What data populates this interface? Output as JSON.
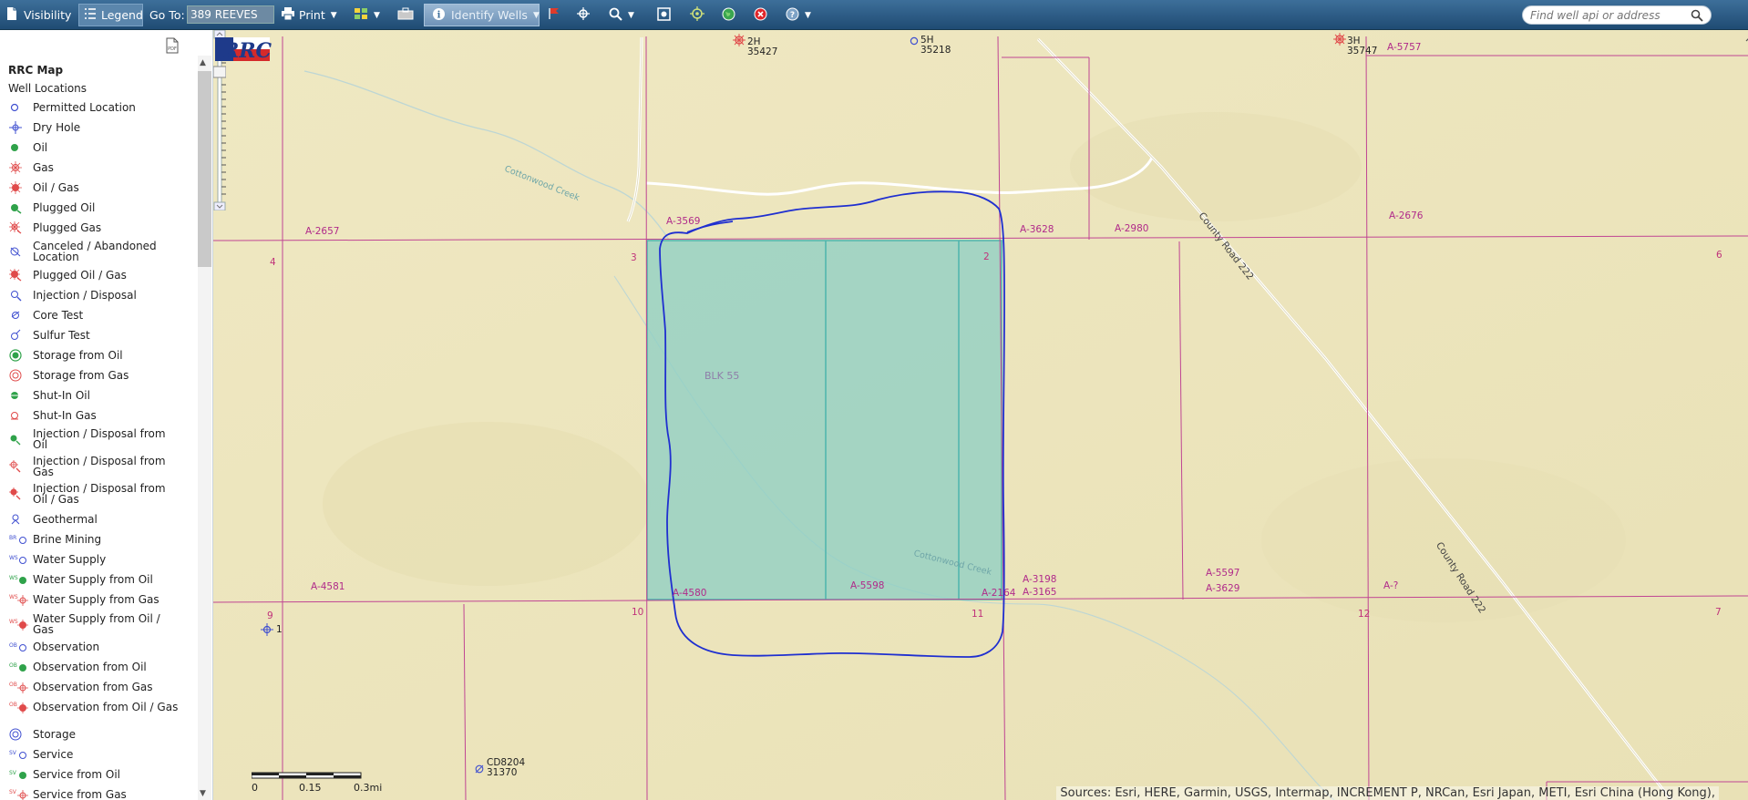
{
  "toolbar": {
    "visibility_label": "Visibility",
    "legend_label": "Legend",
    "goto_label": "Go To:",
    "goto_value": "389 REEVES",
    "print_label": "Print",
    "identify_label": "Identify Wells",
    "search_placeholder": "Find well api or address"
  },
  "legend": {
    "title": "RRC Map",
    "subtitle": "Well Locations",
    "items": [
      {
        "label": "Permitted Location",
        "icon": "permitted-location-icon"
      },
      {
        "label": "Dry Hole",
        "icon": "dry-hole-icon"
      },
      {
        "label": "Oil",
        "icon": "oil-icon"
      },
      {
        "label": "Gas",
        "icon": "gas-icon"
      },
      {
        "label": "Oil / Gas",
        "icon": "oil-gas-icon"
      },
      {
        "label": "Plugged Oil",
        "icon": "plugged-oil-icon"
      },
      {
        "label": "Plugged Gas",
        "icon": "plugged-gas-icon"
      },
      {
        "label": "Canceled / Abandoned Location",
        "icon": "canceled-location-icon"
      },
      {
        "label": "Plugged Oil / Gas",
        "icon": "plugged-oil-gas-icon"
      },
      {
        "label": "Injection / Disposal",
        "icon": "injection-disposal-icon"
      },
      {
        "label": "Core Test",
        "icon": "core-test-icon"
      },
      {
        "label": "Sulfur Test",
        "icon": "sulfur-test-icon"
      },
      {
        "label": "Storage from Oil",
        "icon": "storage-oil-icon"
      },
      {
        "label": "Storage from Gas",
        "icon": "storage-gas-icon"
      },
      {
        "label": "Shut-In Oil",
        "icon": "shut-in-oil-icon"
      },
      {
        "label": "Shut-In Gas",
        "icon": "shut-in-gas-icon"
      },
      {
        "label": "Injection / Disposal from Oil",
        "icon": "injection-oil-icon"
      },
      {
        "label": "Injection / Disposal from Gas",
        "icon": "injection-gas-icon"
      },
      {
        "label": "Injection / Disposal from Oil / Gas",
        "icon": "injection-oil-gas-icon"
      },
      {
        "label": "Geothermal",
        "icon": "geothermal-icon"
      },
      {
        "label": "Brine Mining",
        "icon": "brine-mining-icon"
      },
      {
        "label": "Water Supply",
        "icon": "water-supply-icon"
      },
      {
        "label": "Water Supply from Oil",
        "icon": "water-supply-oil-icon"
      },
      {
        "label": "Water Supply from Gas",
        "icon": "water-supply-gas-icon"
      },
      {
        "label": "Water Supply from Oil / Gas",
        "icon": "water-supply-oil-gas-icon"
      },
      {
        "label": "Observation",
        "icon": "observation-icon"
      },
      {
        "label": "Observation from Oil",
        "icon": "observation-oil-icon"
      },
      {
        "label": "Observation from Gas",
        "icon": "observation-gas-icon"
      },
      {
        "label": "Observation from Oil / Gas",
        "icon": "observation-oil-gas-icon"
      },
      {
        "label": "Storage",
        "icon": "storage-icon"
      },
      {
        "label": "Service",
        "icon": "service-icon"
      },
      {
        "label": "Service from Oil",
        "icon": "service-oil-icon"
      },
      {
        "label": "Service from Gas",
        "icon": "service-gas-icon"
      }
    ]
  },
  "map": {
    "abstracts": [
      "A-2657",
      "A-3569",
      "A-3628",
      "A-2980",
      "A-2676",
      "A-5757",
      "A-4581",
      "A-4580",
      "A-5598",
      "A-2164",
      "A-3198",
      "A-3165",
      "A-5597",
      "A-3629",
      "A-?"
    ],
    "sections": [
      "3",
      "2",
      "4",
      "6",
      "10",
      "11",
      "12",
      "7",
      "9",
      "1"
    ],
    "block_label": "BLK 55",
    "creek_label_1": "Cottonwood Creek",
    "creek_label_2": "Cottonwood Creek",
    "road_label_1": "County Road 222",
    "road_label_2": "County Road 222",
    "wells": [
      {
        "name": "2H",
        "id": "35427"
      },
      {
        "name": "5H",
        "id": "35218"
      },
      {
        "name": "3H",
        "id": "35747"
      },
      {
        "name": "CD8204",
        "id": "31370"
      }
    ],
    "scale": {
      "labels": [
        "0",
        "0.15",
        "0.3mi"
      ]
    },
    "attribution": "Sources: Esri, HERE, Garmin, USGS, Intermap, INCREMENT P, NRCan, Esri Japan, METI, Esri China (Hong Kong),"
  },
  "colors": {
    "toolbar": "#2b5b85",
    "map_bg": "#ede6be",
    "lease_fill": "#8fcfc4",
    "lease_outline": "#1f2fd0",
    "survey_line": "#c04593"
  }
}
